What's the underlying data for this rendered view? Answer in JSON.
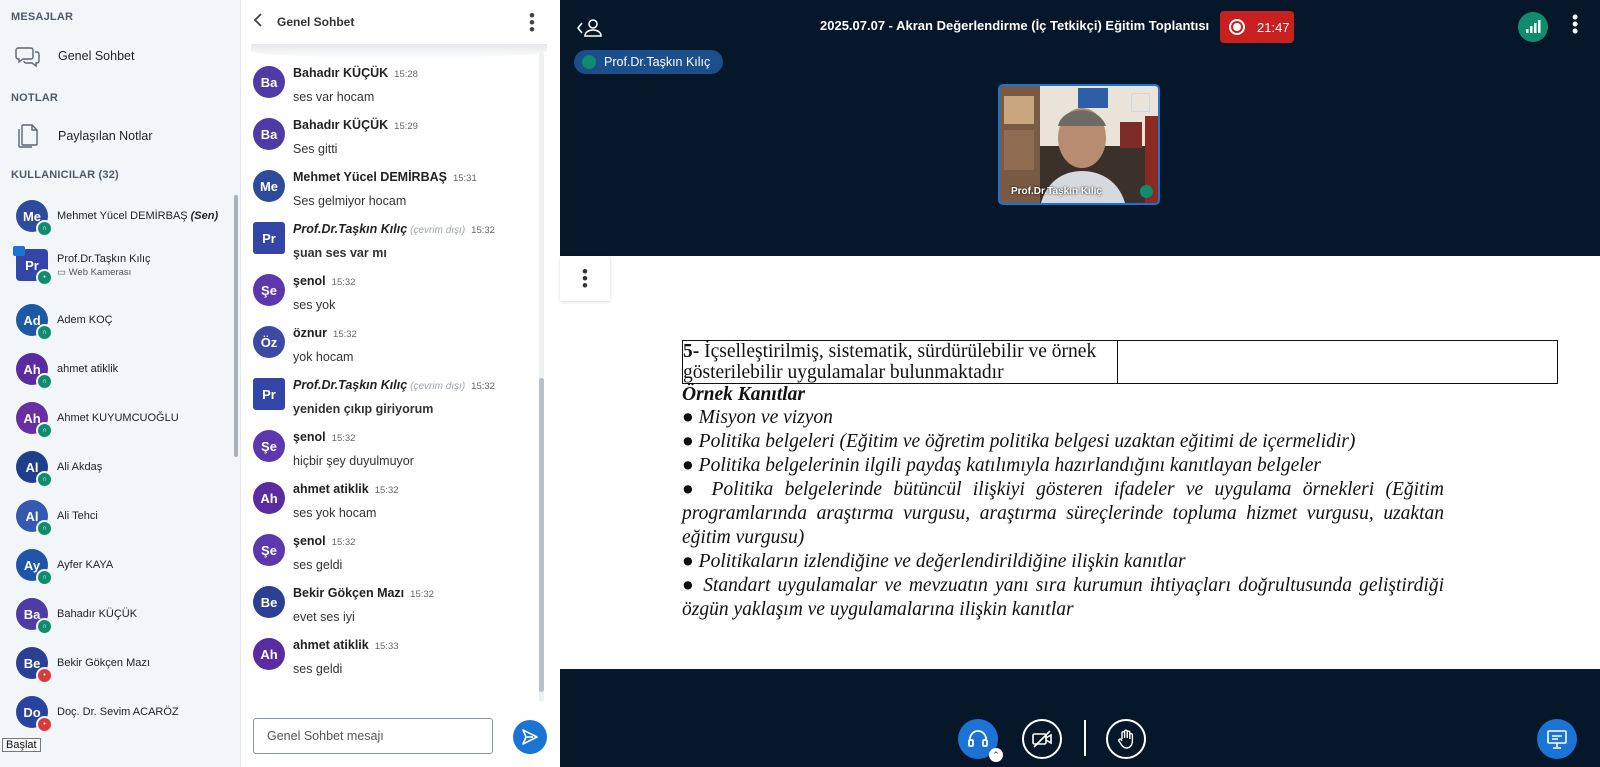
{
  "sidebar": {
    "messages_title": "MESAJLAR",
    "public_chat": "Genel Sohbet",
    "notes_title": "NOTLAR",
    "shared_notes": "Paylaşılan Notlar",
    "users_title": "KULLANICILAR (32)",
    "users": [
      {
        "initials": "Me",
        "name": "Mehmet Yücel DEMİRBAŞ",
        "suffix": "(Sen)",
        "color": "#2e4a9a",
        "badge": "headset"
      },
      {
        "initials": "Pr",
        "name": "Prof.Dr.Taşkın Kılıç",
        "sub": "Web Kamerası",
        "color": "#3346a8",
        "badge": "mic"
      },
      {
        "initials": "Ad",
        "name": "Adem KOÇ",
        "color": "#1c5aa6",
        "badge": "headset"
      },
      {
        "initials": "Ah",
        "name": "ahmet atiklik",
        "color": "#5b2c9f",
        "badge": "headset"
      },
      {
        "initials": "Ah",
        "name": "Ahmet KUYUMCUOĞLU",
        "color": "#6a2ea3",
        "badge": "headset"
      },
      {
        "initials": "Al",
        "name": "Ali Akdaş",
        "color": "#1f3f8c",
        "badge": "headset"
      },
      {
        "initials": "Al",
        "name": "Ali Tehci",
        "color": "#3558b0",
        "badge": "headset"
      },
      {
        "initials": "Ay",
        "name": "Ayfer KAYA",
        "color": "#1f55a8",
        "badge": "headset"
      },
      {
        "initials": "Ba",
        "name": "Bahadır KÜÇÜK",
        "color": "#4e3ba6",
        "badge": "headset"
      },
      {
        "initials": "Be",
        "name": "Bekir Gökçen Mazı",
        "color": "#2b3f93",
        "badge": "muted"
      },
      {
        "initials": "Do",
        "name": "Doç. Dr. Sevim ACARÖZ",
        "color": "#2a43a0",
        "badge": "muted"
      }
    ],
    "taskbar_label": "Başlat"
  },
  "chat": {
    "title": "Genel Sohbet",
    "messages": [
      {
        "initials": "Ba",
        "color": "#4e3ba6",
        "name": "Bahadır KÜÇÜK",
        "time": "15:28",
        "text": "ses var hocam"
      },
      {
        "initials": "Ba",
        "color": "#4e3ba6",
        "name": "Bahadır KÜÇÜK",
        "time": "15:29",
        "text": "Ses gitti"
      },
      {
        "initials": "Me",
        "color": "#2e4a9a",
        "name": "Mehmet Yücel DEMİRBAŞ",
        "time": "15:31",
        "text": "Ses gelmiyor hocam"
      },
      {
        "initials": "Pr",
        "color": "#3346a8",
        "name": "Prof.Dr.Taşkın Kılıç",
        "status": "(çevrim dışı)",
        "time": "15:32",
        "text": "şuan ses var mı",
        "moderator": true
      },
      {
        "initials": "Şe",
        "color": "#5c37ad",
        "name": "şenol",
        "time": "15:32",
        "text": "ses yok"
      },
      {
        "initials": "Öz",
        "color": "#3c4aa6",
        "name": "öznur",
        "time": "15:32",
        "text": "yok hocam"
      },
      {
        "initials": "Pr",
        "color": "#3346a8",
        "name": "Prof.Dr.Taşkın Kılıç",
        "status": "(çevrim dışı)",
        "time": "15:32",
        "text": "yeniden çıkıp giriyorum",
        "moderator": true
      },
      {
        "initials": "Şe",
        "color": "#5c37ad",
        "name": "şenol",
        "time": "15:32",
        "text": "hiçbir şey duyulmuyor"
      },
      {
        "initials": "Ah",
        "color": "#5b2c9f",
        "name": "ahmet atiklik",
        "time": "15:32",
        "text": "ses yok hocam"
      },
      {
        "initials": "Şe",
        "color": "#5c37ad",
        "name": "şenol",
        "time": "15:32",
        "text": "ses geldi"
      },
      {
        "initials": "Be",
        "color": "#2b3f93",
        "name": "Bekir Gökçen Mazı",
        "time": "15:32",
        "text": "evet ses iyi"
      },
      {
        "initials": "Ah",
        "color": "#5b2c9f",
        "name": "ahmet atiklik",
        "time": "15:33",
        "text": "ses geldi"
      }
    ],
    "input_placeholder": "Genel Sohbet mesajı"
  },
  "meeting": {
    "title": "2025.07.07 - Akran Değerlendirme (İç Tetkikçi) Eğitim Toplantısı",
    "recording_time": "21:47",
    "talking_user": "Prof.Dr.Taşkın Kılıç",
    "video_user": "Prof.Dr.Taşkın Kılıç",
    "colors": {
      "background": "#06172a",
      "accent": "#1b74d4",
      "recording": "#c81f1f",
      "connection": "#0f8b6e"
    }
  },
  "slide": {
    "table_num": "5-",
    "table_text": " İçselleştirilmiş, sistematik, sürdürülebilir ve örnek gösterilebilir uygulamalar bulunmaktadır",
    "heading": "Örnek Kanıtlar",
    "lines": [
      "● Misyon ve vizyon",
      "● Politika belgeleri (Eğitim ve öğretim politika belgesi uzaktan eğitimi de içermelidir)",
      "● Politika belgelerinin ilgili paydaş katılımıyla hazırlandığını kanıtlayan belgeler",
      "● Politika belgelerinde bütüncül ilişkiyi gösteren ifadeler ve uygulama örnekleri (Eğitim programlarında araştırma vurgusu, araştırma süreçlerinde topluma hizmet vurgusu, uzaktan eğitim vurgusu)",
      "● Politikaların izlendiğine ve değerlendirildiğine ilişkin kanıtlar",
      "● Standart uygulamalar ve mevzuatın yanı sıra kurumun ihtiyaçları doğrultusunda geliştirdiği özgün yaklaşım ve uygulamalarına ilişkin kanıtlar"
    ]
  }
}
